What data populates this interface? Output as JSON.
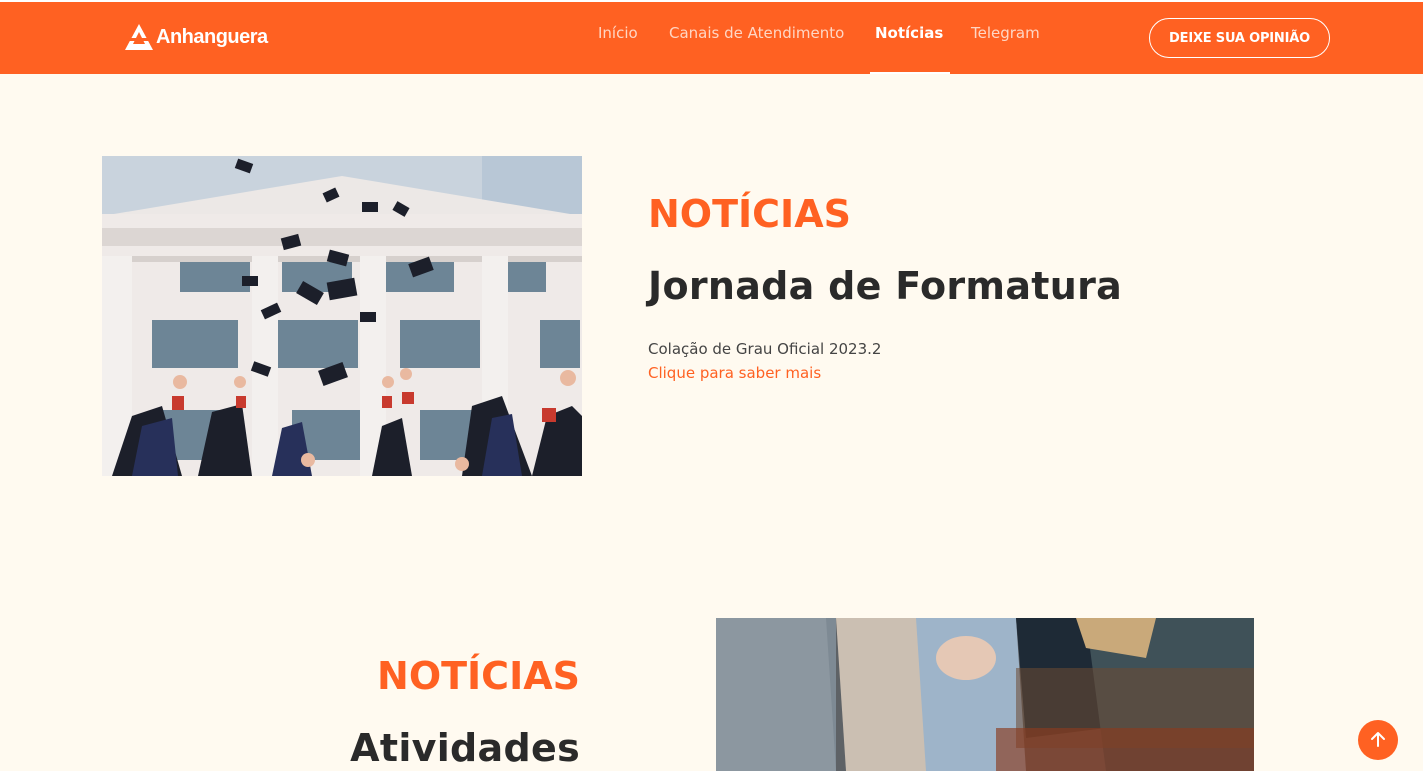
{
  "header": {
    "brand": "Anhanguera",
    "nav": [
      {
        "label": "Início",
        "active": false
      },
      {
        "label": "Canais de Atendimento",
        "active": false
      },
      {
        "label": "Notícias",
        "active": true
      },
      {
        "label": "Telegram",
        "active": false
      }
    ],
    "cta_label": "DEIXE SUA OPINIÃO"
  },
  "news": [
    {
      "kicker": "NOTÍCIAS",
      "title": "Jornada de Formatura",
      "description": "Colação de Grau Oficial 2023.2",
      "link_label": "Clique para saber mais"
    },
    {
      "kicker": "NOTÍCIAS",
      "title": "Atividades"
    }
  ],
  "colors": {
    "brand": "#ff6122",
    "background": "#fffaf0",
    "heading": "#2a2a2a"
  },
  "icons": {
    "logo": "anhanguera-logo-icon",
    "scroll_top": "arrow-up-icon"
  }
}
